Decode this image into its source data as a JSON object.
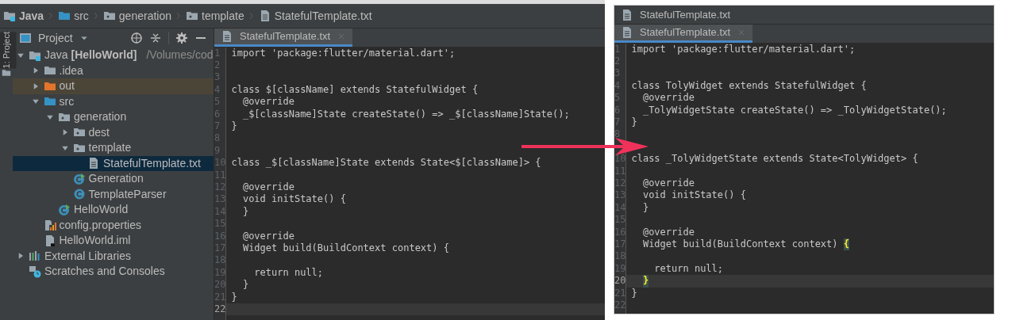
{
  "left": {
    "breadcrumbs": [
      {
        "label": "Java",
        "kind": "module"
      },
      {
        "label": "src",
        "kind": "source"
      },
      {
        "label": "generation",
        "kind": "package"
      },
      {
        "label": "template",
        "kind": "package"
      },
      {
        "label": "StatefulTemplate.txt",
        "kind": "file"
      }
    ],
    "tool_strip": {
      "label": "1: Project"
    },
    "project_panel": {
      "title": "Project",
      "tree": [
        {
          "label": "Java **[HelloWorld]**",
          "path": "/Volumes/cod",
          "kind": "module",
          "expanded": true,
          "selected": false,
          "children": [
            {
              "label": ".idea",
              "kind": "folder",
              "expanded": false,
              "selected": false
            },
            {
              "label": "out",
              "kind": "excluded",
              "expanded": false,
              "selected": false
            },
            {
              "label": "src",
              "kind": "source",
              "expanded": true,
              "selected": false,
              "children": [
                {
                  "label": "generation",
                  "kind": "package",
                  "expanded": true,
                  "selected": false,
                  "children": [
                    {
                      "label": "dest",
                      "kind": "package",
                      "expanded": false,
                      "selected": false
                    },
                    {
                      "label": "template",
                      "kind": "package",
                      "expanded": true,
                      "selected": false,
                      "children": [
                        {
                          "label": "StatefulTemplate.txt",
                          "kind": "file",
                          "selected": true
                        }
                      ]
                    },
                    {
                      "label": "Generation",
                      "kind": "class-run",
                      "selected": false
                    },
                    {
                      "label": "TemplateParser",
                      "kind": "class",
                      "selected": false
                    }
                  ]
                },
                {
                  "label": "HelloWorld",
                  "kind": "class-run",
                  "selected": false
                }
              ]
            },
            {
              "label": "config.properties",
              "kind": "properties",
              "selected": false
            },
            {
              "label": "HelloWorld.iml",
              "kind": "iml",
              "selected": false
            }
          ]
        },
        {
          "label": "External Libraries",
          "kind": "libraries",
          "expanded": false,
          "selected": false
        },
        {
          "label": "Scratches and Consoles",
          "kind": "scratches",
          "selected": false
        }
      ]
    },
    "editor": {
      "tabs": [
        {
          "label": "StatefulTemplate.txt",
          "selected": true
        }
      ],
      "lines": [
        {
          "number": "1",
          "code": "import 'package:flutter/material.dart';",
          "current": false
        },
        {
          "number": "2",
          "current": false
        },
        {
          "number": "3",
          "current": false
        },
        {
          "number": "4",
          "code": "class $[className] extends StatefulWidget {",
          "current": false
        },
        {
          "number": "5",
          "code": "  @override",
          "current": false
        },
        {
          "number": "6",
          "code": "  _$[className]State createState() => _$[className]State();",
          "current": false
        },
        {
          "number": "7",
          "code": "}",
          "current": false
        },
        {
          "number": "8",
          "current": false
        },
        {
          "number": "9",
          "current": false
        },
        {
          "number": "10",
          "code": "class _$[className]State extends State<$[className]> {",
          "current": false
        },
        {
          "number": "11",
          "current": false
        },
        {
          "number": "12",
          "code": "  @override",
          "current": false
        },
        {
          "number": "13",
          "code": "  void initState() {",
          "current": false
        },
        {
          "number": "14",
          "code": "  }",
          "current": false
        },
        {
          "number": "15",
          "current": false
        },
        {
          "number": "16",
          "code": "  @override",
          "current": false
        },
        {
          "number": "17",
          "code": "  Widget build(BuildContext context) {",
          "current": false
        },
        {
          "number": "18",
          "current": false
        },
        {
          "number": "19",
          "code": "    return null;",
          "current": false
        },
        {
          "number": "20",
          "code": "  }",
          "current": false
        },
        {
          "number": "21",
          "code": "}",
          "current": false
        },
        {
          "number": "22",
          "current": true
        }
      ]
    }
  },
  "right": {
    "window": {
      "title": "StatefulTemplate.txt"
    },
    "editor": {
      "tabs": [
        {
          "label": "StatefulTemplate.txt",
          "selected": true
        }
      ],
      "lines": [
        {
          "number": "1",
          "code": "import 'package:flutter/material.dart';",
          "current": false
        },
        {
          "number": "2",
          "current": false
        },
        {
          "number": "3",
          "current": false
        },
        {
          "number": "4",
          "code": "class TolyWidget extends StatefulWidget {",
          "current": false
        },
        {
          "number": "5",
          "code": "  @override",
          "current": false
        },
        {
          "number": "6",
          "code": "  _TolyWidgetState createState() => _TolyWidgetState();",
          "current": false
        },
        {
          "number": "7",
          "code": "}",
          "current": false
        },
        {
          "number": "8",
          "current": false
        },
        {
          "current": false
        },
        {
          "number": "10",
          "code": "class _TolyWidgetState extends State<TolyWidget> {",
          "current": false
        },
        {
          "number": "11",
          "current": false
        },
        {
          "number": "12",
          "code": "  @override",
          "current": false
        },
        {
          "number": "13",
          "code": "  void initState() {",
          "current": false
        },
        {
          "number": "14",
          "code": "  }",
          "current": false
        },
        {
          "number": "15",
          "current": false
        },
        {
          "number": "16",
          "code": "  @override",
          "current": false
        },
        {
          "number": "17",
          "code": "  Widget build(BuildContext context)",
          "brace": "{",
          "current": false
        },
        {
          "number": "18",
          "current": false
        },
        {
          "number": "19",
          "code": "    return null;",
          "current": false
        },
        {
          "number": "20",
          "brace": "}",
          "current": true
        },
        {
          "number": "21",
          "code": "}",
          "current": false
        },
        {
          "number": "22",
          "current": false
        }
      ]
    }
  }
}
